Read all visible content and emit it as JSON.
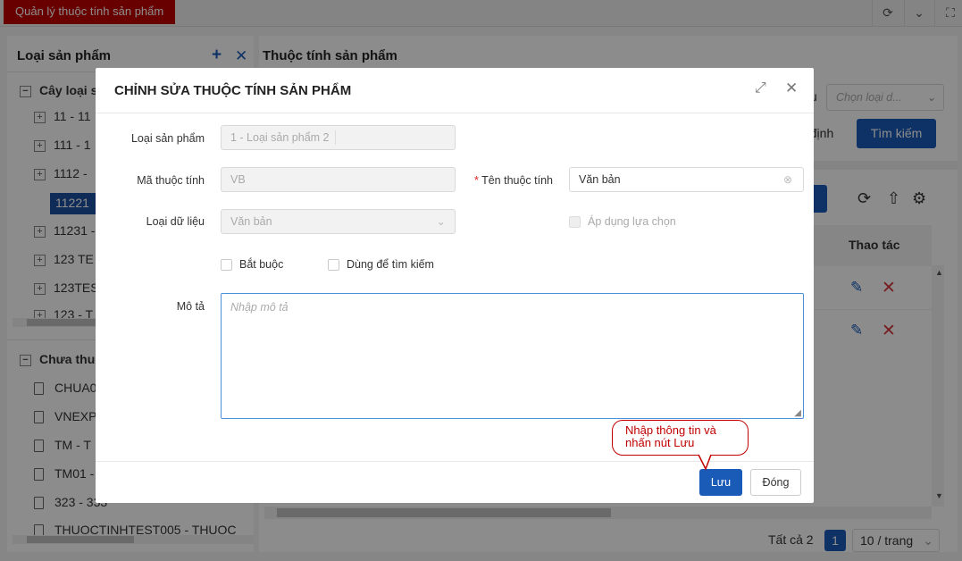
{
  "top_tab": "Quản lý thuộc tính sản phẩm",
  "left_panel": {
    "title": "Loại sản phẩm",
    "tree_root": "Cây loại s",
    "tree_items": [
      "11 - 11",
      "111 - 1",
      "1112 - ",
      "11221",
      "11231 -",
      "123 TE",
      "123TES",
      "123 - T"
    ],
    "uncat_title": "Chưa thu",
    "uncat_items": [
      "CHUA0",
      "VNEXP",
      "TM - T",
      "TM01 -",
      "323 - 333",
      "THUOCTINHTEST005 - THUOC"
    ]
  },
  "right_panel": {
    "title": "Thuộc tính sản phẩm",
    "select_placeholder": "Chọn loại d...",
    "default_button": "định",
    "search_button": "Tìm kiếm",
    "col_actions": "Thao tác",
    "total": "Tất cả 2",
    "page": "1",
    "page_size": "10 / trang",
    "pre_select_text": "u"
  },
  "modal": {
    "title": "CHỈNH SỬA THUỘC TÍNH SẢN PHẨM",
    "label_product_type": "Loại sản phẩm",
    "value_product_type": "1 - Loại sản phẩm 2",
    "label_code": "Mã thuộc tính",
    "value_code": "VB",
    "label_name_required": "*",
    "label_name": "Tên thuộc tính",
    "value_name": "Văn bản",
    "label_data_type": "Loại dữ liệu",
    "value_data_type": "Văn bản",
    "apply_option": "Áp dụng lựa chọn",
    "required_cb": "Bắt buộc",
    "search_cb": "Dùng để tìm kiếm",
    "label_desc": "Mô tả",
    "desc_placeholder": "Nhập mô tả",
    "save": "Lưu",
    "close": "Đóng"
  },
  "callout": "Nhập thông tin và nhấn nút Lưu",
  "colors": {
    "accent": "#1a5bb8",
    "tab_red": "#c00000",
    "delete_red": "#d9363e"
  }
}
